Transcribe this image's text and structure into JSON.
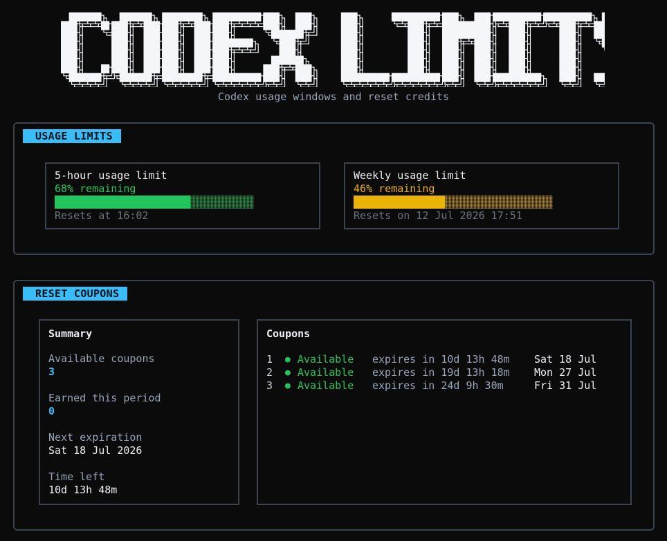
{
  "banner": {
    "title": "CODEX LIMITS",
    "subtitle": "Codex usage windows and reset credits"
  },
  "usage": {
    "tag": "USAGE LIMITS",
    "limits": [
      {
        "title": "5-hour usage limit",
        "remaining_text": "68% remaining",
        "percent": 68,
        "color": "#22c55e",
        "reset_text": "Resets at 16:02"
      },
      {
        "title": "Weekly usage limit",
        "remaining_text": "46% remaining",
        "percent": 46,
        "color": "#eab308",
        "reset_text": "Resets on 12 Jul 2026 17:51"
      }
    ]
  },
  "coupons": {
    "tag": "RESET COUPONS",
    "summary": {
      "heading": "Summary",
      "available_label": "Available coupons",
      "available_value": "3",
      "earned_label": "Earned this period",
      "earned_value": "0",
      "next_label": "Next expiration",
      "next_value": "Sat 18 Jul 2026",
      "time_label": "Time left",
      "time_value": "10d 13h 48m"
    },
    "list": {
      "heading": "Coupons",
      "items": [
        {
          "num": "1",
          "status": "Available",
          "expires": "expires in 10d 13h 48m",
          "date": "Sat 18 Jul"
        },
        {
          "num": "2",
          "status": "Available",
          "expires": "expires in 19d 13h 18m",
          "date": "Mon 27 Jul"
        },
        {
          "num": "3",
          "status": "Available",
          "expires": "expires in 24d 9h 30m",
          "date": "Fri 31 Jul"
        }
      ]
    }
  },
  "colors": {
    "accent": "#38bdf8",
    "success": "#22c55e",
    "warning": "#eab308",
    "border": "#3a4350",
    "background": "#0b0b0c"
  },
  "icons": {
    "status_dot": "status-dot-icon"
  }
}
